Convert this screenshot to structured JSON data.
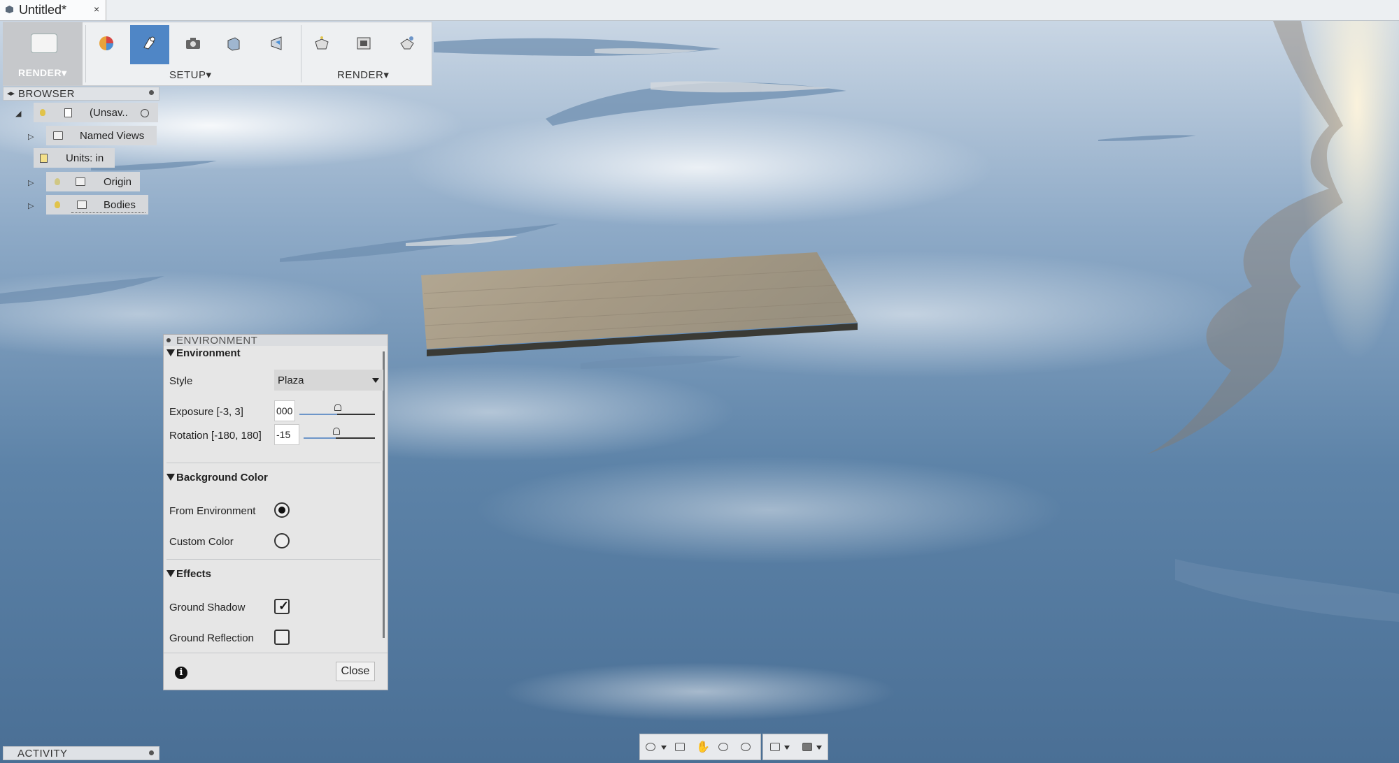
{
  "document": {
    "title": "Untitled*",
    "close_symbol": "×"
  },
  "toolbar": {
    "workspace_label": "RENDER▾",
    "setup_label": "SETUP▾",
    "render_label": "RENDER▾",
    "buttons": [
      {
        "name": "appearance-icon",
        "active": false
      },
      {
        "name": "scene-settings-icon",
        "active": true
      },
      {
        "name": "camera-icon",
        "active": false
      },
      {
        "name": "texture-map-icon",
        "active": false
      },
      {
        "name": "decal-icon",
        "active": false
      },
      {
        "name": "render-icon",
        "active": false
      },
      {
        "name": "render-gallery-icon",
        "active": false
      },
      {
        "name": "in-canvas-render-icon",
        "active": false
      }
    ]
  },
  "browser": {
    "title": "BROWSER",
    "root_label": "(Unsav..",
    "items": [
      {
        "label": "Named Views"
      },
      {
        "label": "Units: in"
      },
      {
        "label": "Origin"
      },
      {
        "label": "Bodies"
      }
    ]
  },
  "environment_panel": {
    "title": "ENVIRONMENT",
    "section_environment": "Environment",
    "style_label": "Style",
    "style_value": "Plaza",
    "exposure_label": "Exposure [-3, 3]",
    "exposure_value": "000",
    "exposure_level_fraction": 0.5,
    "rotation_label": "Rotation [-180, 180]",
    "rotation_value": "-15",
    "section_background": "Background Color",
    "from_environment_label": "From Environment",
    "from_environment_selected": true,
    "custom_color_label": "Custom Color",
    "custom_color_selected": false,
    "section_effects": "Effects",
    "ground_shadow_label": "Ground Shadow",
    "ground_shadow_checked": true,
    "ground_reflection_label": "Ground Reflection",
    "ground_reflection_checked": false,
    "info_symbol": "i",
    "close_label": "Close"
  },
  "activity": {
    "title": "ACTIVITY"
  },
  "colors": {
    "accent": "#4f86c6",
    "panel_bg": "#e6e6e6",
    "water_dark": "#4a6f95"
  }
}
